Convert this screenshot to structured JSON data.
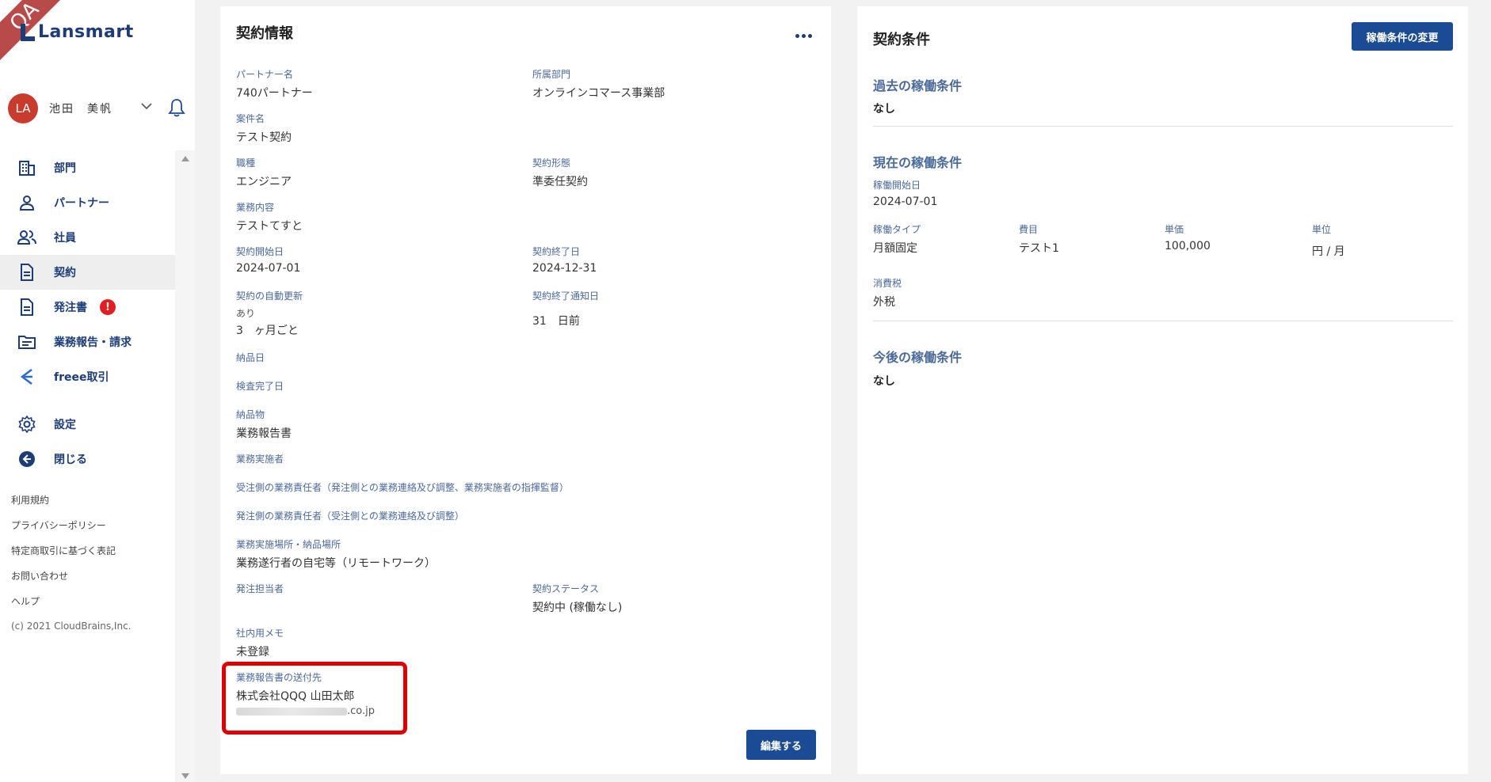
{
  "env_badge": "QA",
  "brand": {
    "name": "Lansmart"
  },
  "user": {
    "initials": "LA",
    "name": "池田　美帆"
  },
  "nav": [
    {
      "label": "部門",
      "icon": "building-icon"
    },
    {
      "label": "パートナー",
      "icon": "person-icon"
    },
    {
      "label": "社員",
      "icon": "people-icon"
    },
    {
      "label": "契約",
      "icon": "document-icon"
    },
    {
      "label": "発注書",
      "icon": "document-icon",
      "badge": "!"
    },
    {
      "label": "業務報告・請求",
      "icon": "folder-icon"
    },
    {
      "label": "freee取引",
      "icon": "freee-icon"
    },
    {
      "label": "設定",
      "icon": "gear-icon"
    },
    {
      "label": "閉じる",
      "icon": "arrow-left-circle-icon"
    }
  ],
  "footer_links": [
    "利用規約",
    "プライバシーポリシー",
    "特定商取引に基づく表記",
    "お問い合わせ",
    "ヘルプ"
  ],
  "copyright": "(c) 2021 CloudBrains,Inc.",
  "contract": {
    "title": "契約情報",
    "partner_name": {
      "label": "パートナー名",
      "value": "740パートナー"
    },
    "department": {
      "label": "所属部門",
      "value": "オンラインコマース事業部"
    },
    "project_name": {
      "label": "案件名",
      "value": "テスト契約"
    },
    "job_type": {
      "label": "職種",
      "value": "エンジニア"
    },
    "contract_form": {
      "label": "契約形態",
      "value": "準委任契約"
    },
    "work_content": {
      "label": "業務内容",
      "value": "テストてすと"
    },
    "start_date": {
      "label": "契約開始日",
      "value": "2024-07-01"
    },
    "end_date": {
      "label": "契約終了日",
      "value": "2024-12-31"
    },
    "auto_renew": {
      "label": "契約の自動更新",
      "value1": "あり",
      "value2": "3　ヶ月ごと"
    },
    "end_notice": {
      "label": "契約終了通知日",
      "value": "31　日前"
    },
    "delivery_date": {
      "label": "納品日"
    },
    "inspection_date": {
      "label": "検査完了日"
    },
    "deliverables": {
      "label": "納品物",
      "value": "業務報告書"
    },
    "executor": {
      "label": "業務実施者"
    },
    "recv_manager": {
      "label": "受注側の業務責任者（発注側との業務連絡及び調整、業務実施者の指揮監督）"
    },
    "order_manager": {
      "label": "発注側の業務責任者（受注側との業務連絡及び調整）"
    },
    "work_place": {
      "label": "業務実施場所・納品場所",
      "value": "業務遂行者の自宅等（リモートワーク）"
    },
    "order_contact": {
      "label": "発注担当者"
    },
    "status": {
      "label": "契約ステータス",
      "value": "契約中 (稼働なし)"
    },
    "memo": {
      "label": "社内用メモ",
      "value": "未登録"
    },
    "report_dest": {
      "label": "業務報告書の送付先",
      "value": "株式会社QQQ 山田太郎",
      "email_suffix": ".co.jp"
    },
    "edit_button": "編集する"
  },
  "conditions": {
    "title": "契約条件",
    "change_button": "稼働条件の変更",
    "past": {
      "title": "過去の稼働条件",
      "value": "なし"
    },
    "current": {
      "title": "現在の稼働条件",
      "start": {
        "label": "稼働開始日",
        "value": "2024-07-01"
      },
      "type": {
        "label": "稼働タイプ",
        "value": "月額固定"
      },
      "cost_item": {
        "label": "費目",
        "value": "テスト1"
      },
      "unit_price": {
        "label": "単価",
        "value": "100,000"
      },
      "unit": {
        "label": "単位",
        "value": "円 / 月"
      },
      "tax": {
        "label": "消費税",
        "value": "外税"
      }
    },
    "future": {
      "title": "今後の稼働条件",
      "value": "なし"
    }
  }
}
